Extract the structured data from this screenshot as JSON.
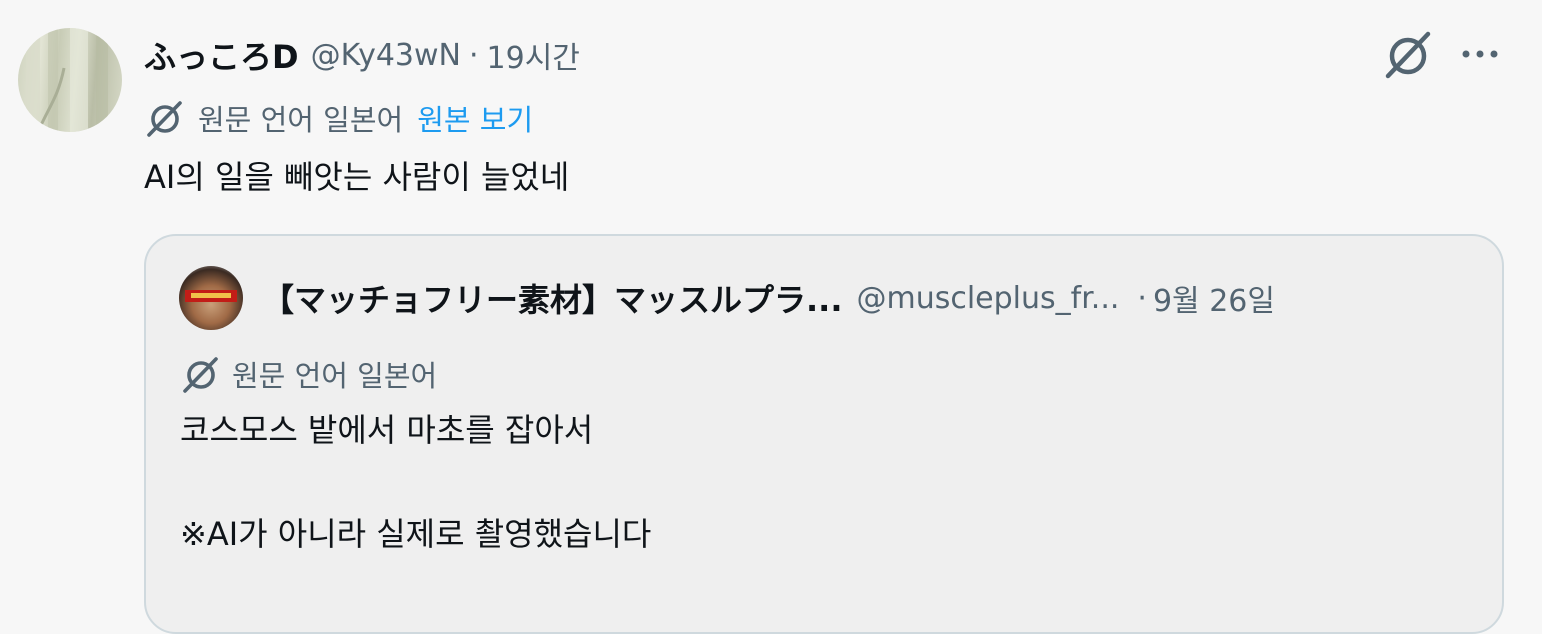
{
  "tweet": {
    "display_name": "ふっころD",
    "handle": "@Ky43wN",
    "separator": "·",
    "time": "19시간",
    "translation": {
      "source_label": "원문 언어 일본어",
      "show_original": "원본 보기"
    },
    "text": "AI의 일을 빼앗는 사람이 늘었네"
  },
  "quote": {
    "display_name": "【マッチョフリー素材】マッスルプラ...",
    "handle": "@muscleplus_fr...",
    "separator": "·",
    "time": "9월 26일",
    "translation_label": "원문 언어 일본어",
    "text_line1": "코스모스 밭에서 마초를 잡아서",
    "text_line2": "※AI가 아니라 실제로 촬영했습니다"
  },
  "icons": {
    "grok": "grok-icon",
    "more": "more-icon",
    "translate": "translate-icon"
  },
  "colors": {
    "text": "#0f1419",
    "secondary": "#536471",
    "link": "#1d9bf0",
    "border": "#cfd9de",
    "background": "#f7f7f7"
  }
}
